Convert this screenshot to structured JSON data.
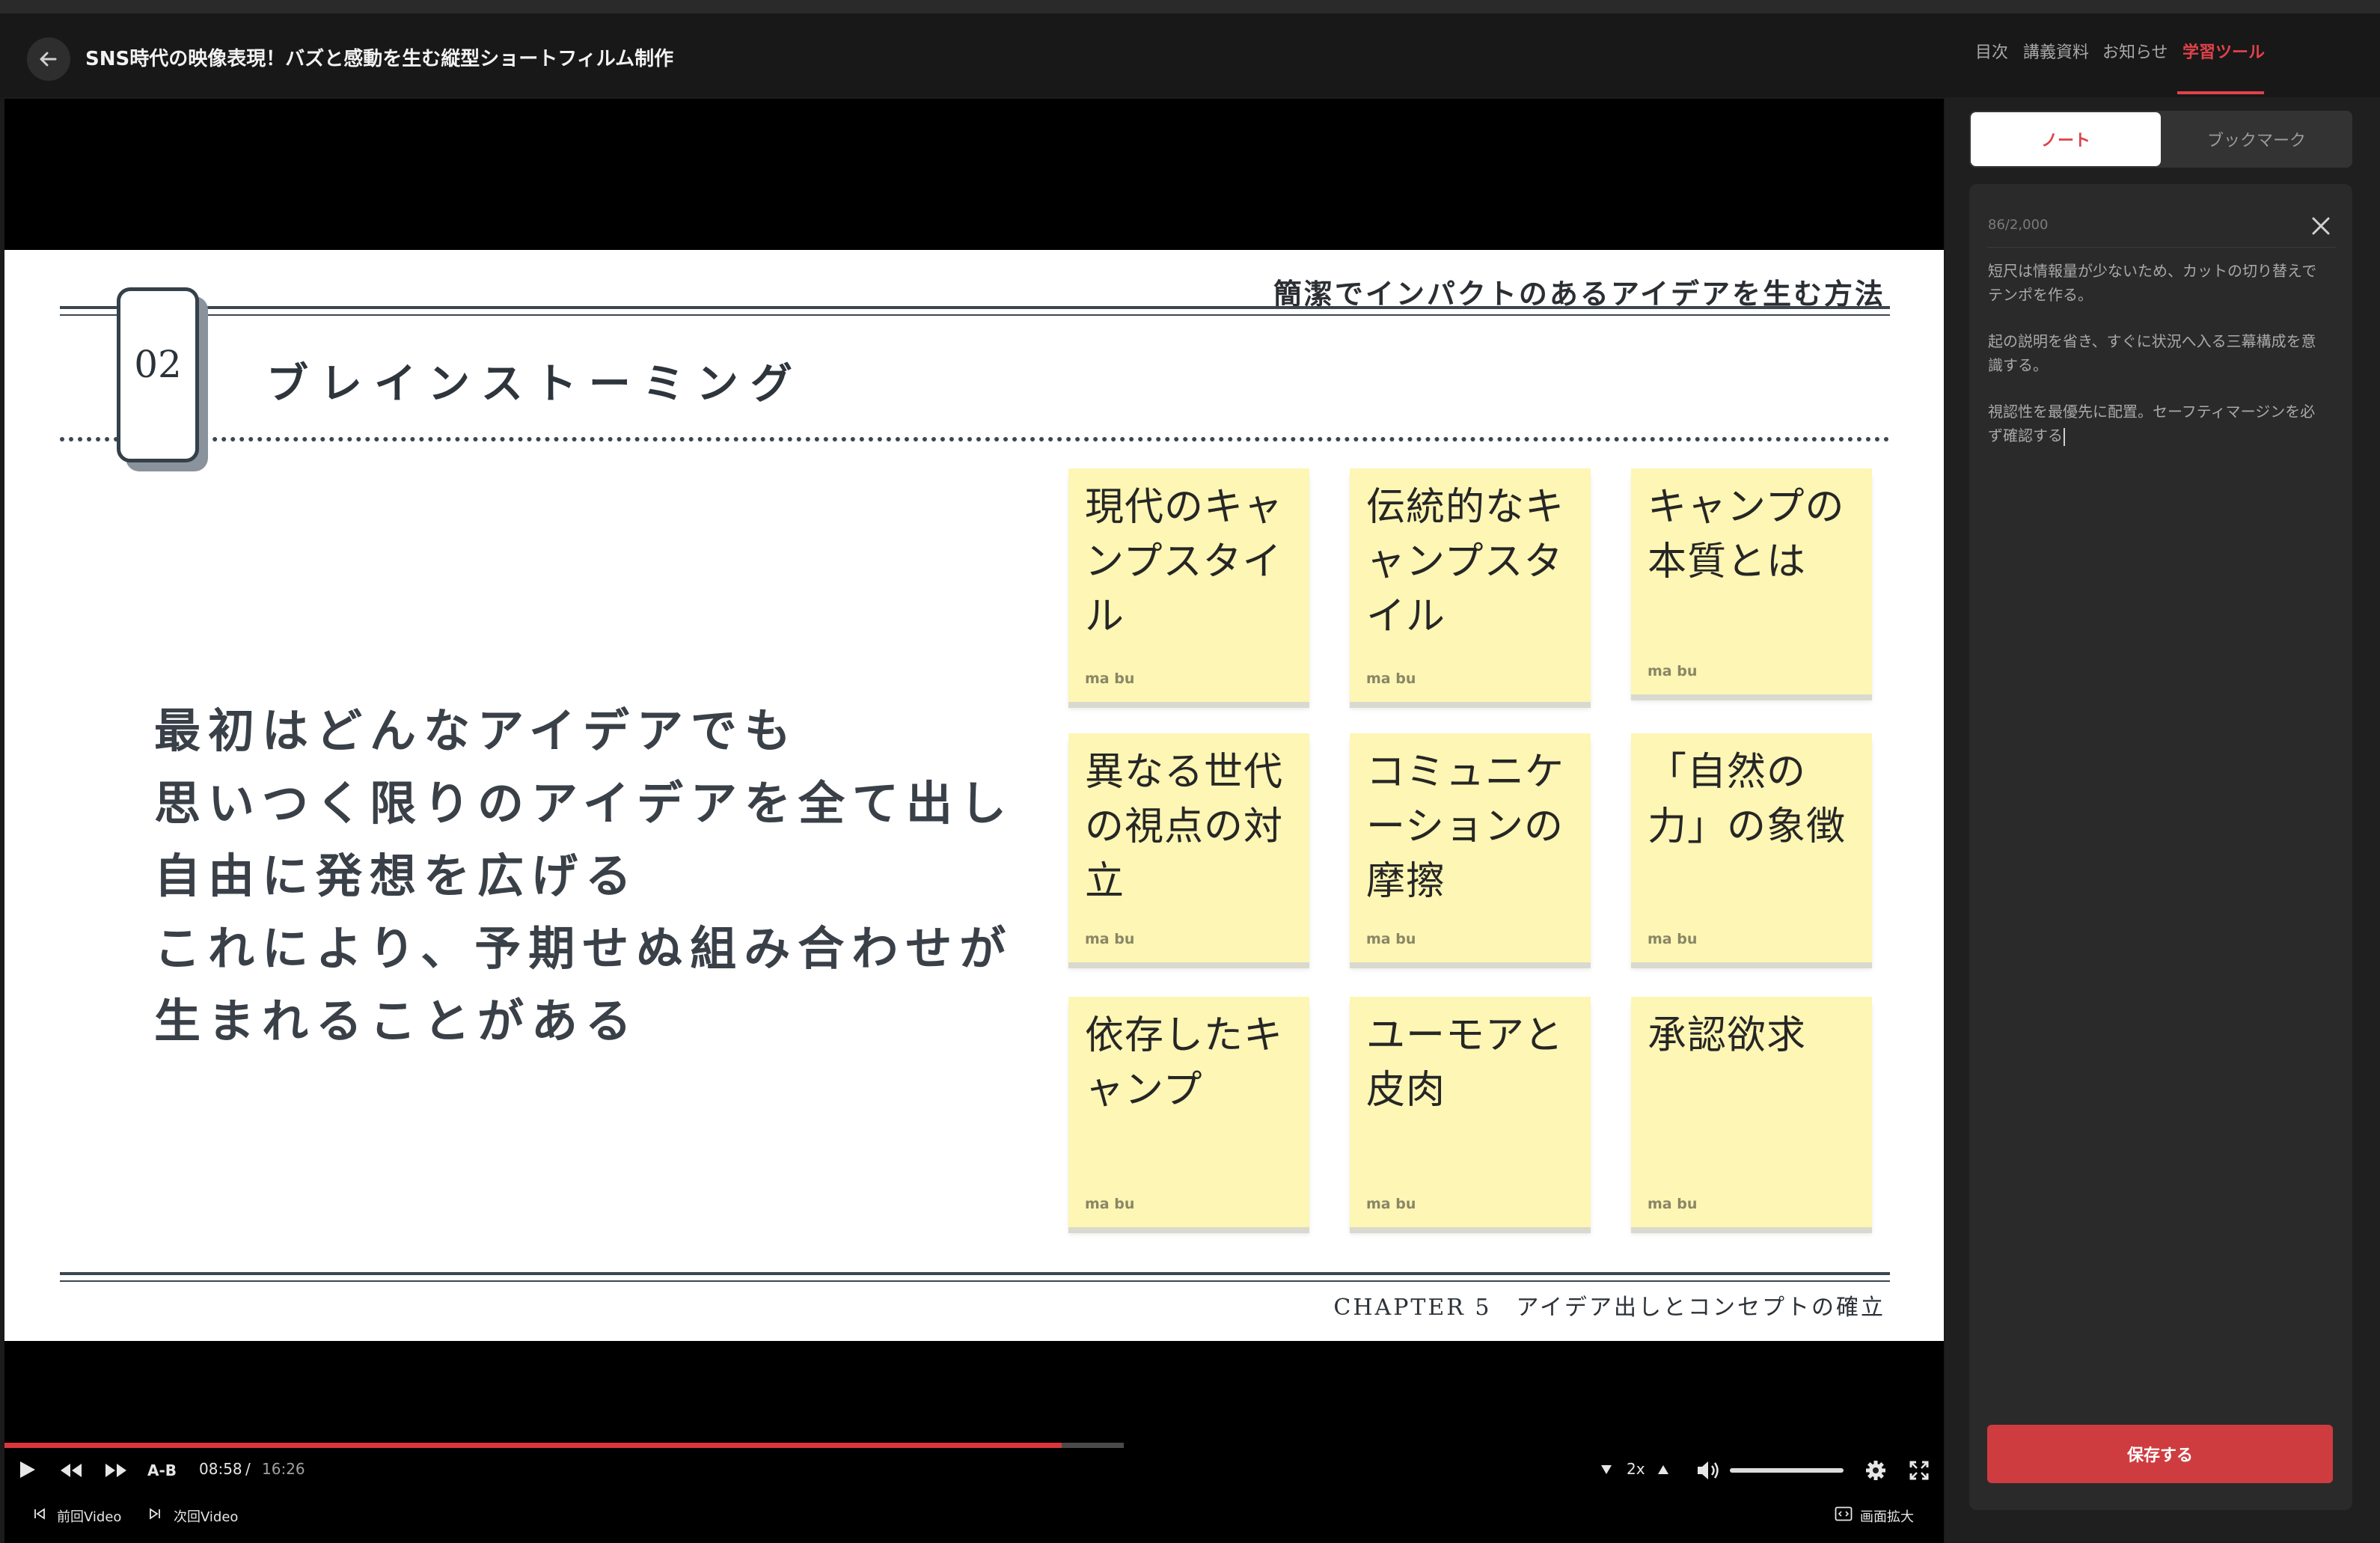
{
  "header": {
    "title": "SNS時代の映像表現！バズと感動を生む縦型ショートフィルム制作",
    "tabs": [
      "目次",
      "講義資料",
      "お知らせ",
      "学習ツール"
    ],
    "active_tab": "学習ツール"
  },
  "slide": {
    "subtitle": "簡潔でインパクトのあるアイデアを生む方法",
    "number": "02",
    "heading": "ブレインストーミング",
    "body_lines": [
      "最初はどんなアイデアでも",
      "思いつく限りのアイデアを全て出し",
      "自由に発想を広げる",
      "これにより、予期せぬ組み合わせが",
      "生まれることがある"
    ],
    "notes": [
      {
        "lines": [
          "現代のキャ",
          "ンプスタイ",
          "ル"
        ],
        "author": "ma bu"
      },
      {
        "lines": [
          "伝統的なキ",
          "ャンプスタ",
          "イル"
        ],
        "author": "ma bu"
      },
      {
        "lines": [
          "キャンプの",
          "本質とは"
        ],
        "author": "ma bu"
      },
      {
        "lines": [
          "異なる世代",
          "の視点の対",
          "立"
        ],
        "author": "ma bu"
      },
      {
        "lines": [
          "コミュニケ",
          "ーションの",
          "摩擦"
        ],
        "author": "ma bu"
      },
      {
        "lines": [
          "「自然の",
          "力」の象徴"
        ],
        "author": "ma bu"
      },
      {
        "lines": [
          "依存したキ",
          "ャンプ"
        ],
        "author": "ma bu"
      },
      {
        "lines": [
          "ユーモアと",
          "皮肉"
        ],
        "author": "ma bu"
      },
      {
        "lines": [
          "承認欲求"
        ],
        "author": "ma bu"
      }
    ],
    "chapter": "CHAPTER 5　アイデア出しとコンセプトの確立"
  },
  "player": {
    "ab_label": "A-B",
    "current_time": "08:58",
    "time_separator": "/",
    "total_time": "16:26",
    "progress": 0.545,
    "buffered": 0.577,
    "speed": "2x",
    "volume": 1.0,
    "prev_label": "前回Video",
    "next_label": "次回Video",
    "expand_label": "画面拡大",
    "accent_color": "#d9373d"
  },
  "panel": {
    "seg_note": "ノート",
    "seg_bookmark": "ブックマーク",
    "char_count": "86/2,000",
    "note_lines": [
      "短尺は情報量が少ないため、カットの切り替えで",
      "テンポを作る。",
      "",
      "起の説明を省き、すぐに状況へ入る三幕構成を意",
      "識する。",
      "",
      "視認性を最優先に配置。セーフティマージンを必",
      "ず確認する"
    ],
    "save_label": "保存する",
    "accent_color": "#e0424a"
  }
}
